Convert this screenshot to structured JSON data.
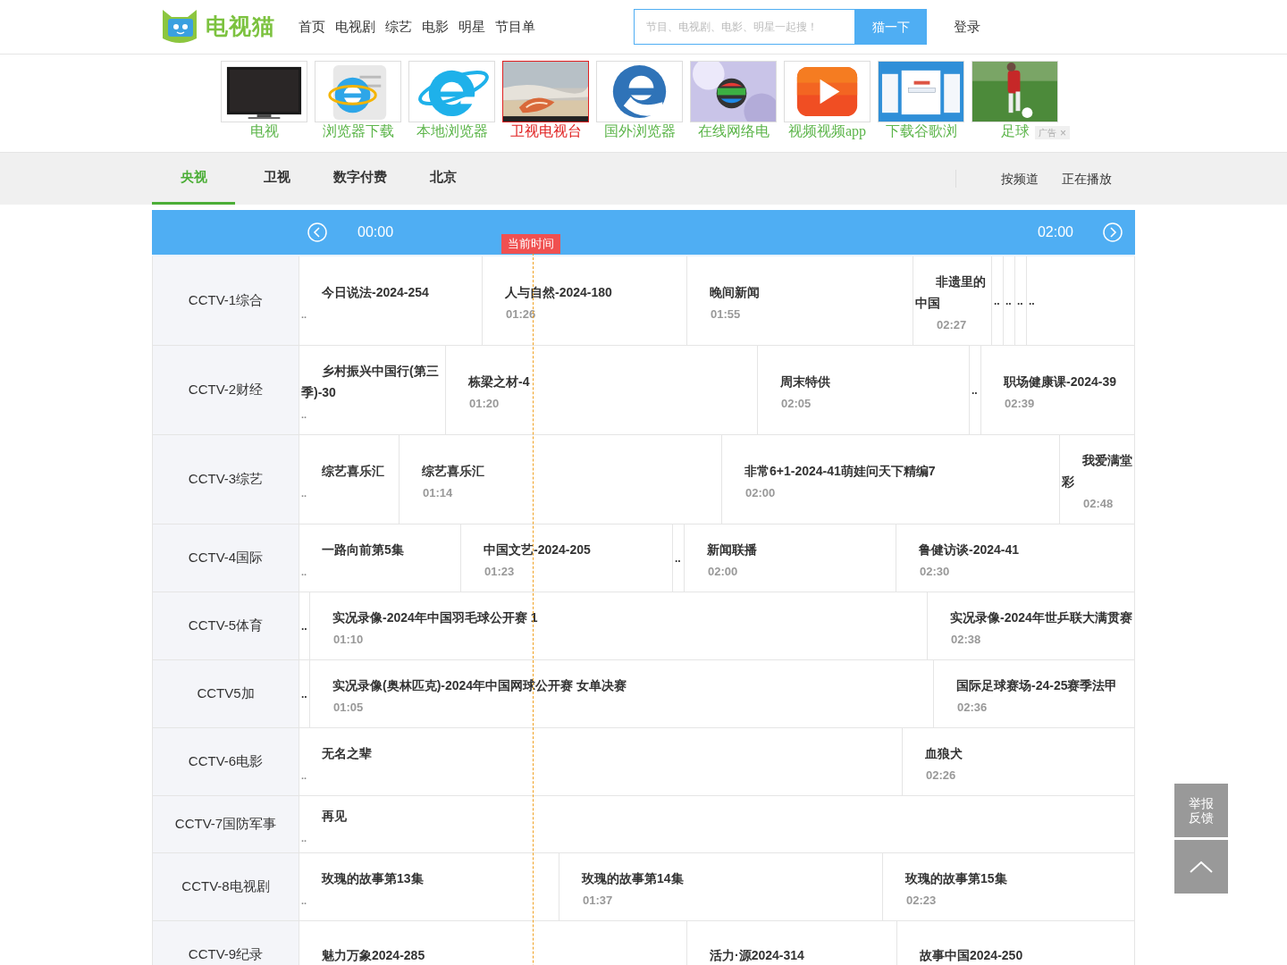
{
  "header": {
    "logo": "电视猫",
    "nav": [
      "首页",
      "电视剧",
      "综艺",
      "电影",
      "明星",
      "节目单"
    ],
    "search": {
      "placeholder": "节目、电视剧、电影、明星一起搜！",
      "button": "猫一下"
    },
    "login": "登录"
  },
  "ads": [
    {
      "label": "电视",
      "selected": false
    },
    {
      "label": "浏览器下载",
      "selected": false
    },
    {
      "label": "本地浏览器",
      "selected": false
    },
    {
      "label": "卫视电视台",
      "selected": true
    },
    {
      "label": "国外浏览器",
      "selected": false
    },
    {
      "label": "在线网络电",
      "selected": false
    },
    {
      "label": "视频视频app",
      "selected": false
    },
    {
      "label": "下载谷歌浏",
      "selected": false
    },
    {
      "label": "足球",
      "selected": false
    }
  ],
  "ad_badge": {
    "label": "广告",
    "close": "×"
  },
  "tabs": [
    {
      "label": "央视",
      "selected": true
    },
    {
      "label": "卫视",
      "selected": false
    },
    {
      "label": "数字付费",
      "selected": false
    },
    {
      "label": "北京",
      "selected": false
    }
  ],
  "view_links": [
    "按频道",
    "正在播放"
  ],
  "timeline": {
    "start": "00:00",
    "end": "02:00",
    "now_label": "当前时间"
  },
  "rows": [
    {
      "channel": "CCTV-1综合",
      "programs": [
        {
          "kind": "show",
          "title": "今日说法-2024-254",
          "more": ".."
        },
        {
          "kind": "show",
          "title": "人与自然-2024-180",
          "time": "01:26"
        },
        {
          "kind": "show",
          "title": "晚间新闻",
          "time": "01:55"
        },
        {
          "kind": "show",
          "title": "非遗里的中国",
          "time": "02:27"
        },
        {
          "kind": "gap",
          "text": ".."
        },
        {
          "kind": "gap",
          "text": ".."
        },
        {
          "kind": "gap",
          "text": ".."
        },
        {
          "kind": "gap",
          "text": ".."
        }
      ]
    },
    {
      "channel": "CCTV-2财经",
      "programs": [
        {
          "kind": "show",
          "title": "乡村振兴中国行(第三季)-30",
          "more": ".."
        },
        {
          "kind": "show",
          "title": "栋梁之材-4",
          "time": "01:20"
        },
        {
          "kind": "show",
          "title": "周末特供",
          "time": "02:05"
        },
        {
          "kind": "gap",
          "text": ".."
        },
        {
          "kind": "show",
          "title": "职场健康课-2024-39",
          "time": "02:39"
        }
      ]
    },
    {
      "channel": "CCTV-3综艺",
      "programs": [
        {
          "kind": "show",
          "title": "综艺喜乐汇",
          "more": ".."
        },
        {
          "kind": "show",
          "title": "综艺喜乐汇",
          "time": "01:14"
        },
        {
          "kind": "show",
          "title": "非常6+1-2024-41萌娃问天下精编7",
          "time": "02:00"
        },
        {
          "kind": "show",
          "title": "我爱满堂彩",
          "time": "02:48"
        }
      ]
    },
    {
      "channel": "CCTV-4国际",
      "programs": [
        {
          "kind": "show",
          "title": "一路向前第5集",
          "more": ".."
        },
        {
          "kind": "show",
          "title": "中国文艺-2024-205",
          "time": "01:23"
        },
        {
          "kind": "gap",
          "text": ".."
        },
        {
          "kind": "show",
          "title": "新闻联播",
          "time": "02:00"
        },
        {
          "kind": "show",
          "title": "鲁健访谈-2024-41",
          "time": "02:30"
        }
      ]
    },
    {
      "channel": "CCTV-5体育",
      "programs": [
        {
          "kind": "gap",
          "text": ".."
        },
        {
          "kind": "show",
          "title": "实况录像-2024年中国羽毛球公开赛 1",
          "time": "01:10"
        },
        {
          "kind": "show",
          "title": "实况录像-2024年世乒联大满贯赛",
          "time": "02:38"
        }
      ]
    },
    {
      "channel": "CCTV5加",
      "programs": [
        {
          "kind": "gap",
          "text": ".."
        },
        {
          "kind": "show",
          "title": "实况录像(奥林匹克)-2024年中国网球公开赛 女单决赛",
          "time": "01:05"
        },
        {
          "kind": "show",
          "title": "国际足球赛场-24-25赛季法甲",
          "time": "02:36"
        }
      ]
    },
    {
      "channel": "CCTV-6电影",
      "programs": [
        {
          "kind": "show",
          "title": "无名之辈",
          "more": ".."
        },
        {
          "kind": "show",
          "title": "血狼犬",
          "time": "02:26"
        }
      ]
    },
    {
      "channel": "CCTV-7国防军事",
      "programs": [
        {
          "kind": "show",
          "title": "再见",
          "more": ".."
        }
      ]
    },
    {
      "channel": "CCTV-8电视剧",
      "programs": [
        {
          "kind": "show",
          "title": "玫瑰的故事第13集",
          "more": ".."
        },
        {
          "kind": "show",
          "title": "玫瑰的故事第14集",
          "time": "01:37"
        },
        {
          "kind": "show",
          "title": "玫瑰的故事第15集",
          "time": "02:23"
        }
      ]
    },
    {
      "channel": "CCTV-9纪录",
      "programs": [
        {
          "kind": "show",
          "title": "魅力万象2024-285"
        },
        {
          "kind": "show",
          "title": "活力·源2024-314"
        },
        {
          "kind": "show",
          "title": "故事中国2024-250"
        }
      ]
    }
  ],
  "float_buttons": {
    "feedback": [
      "举报",
      "反馈"
    ]
  }
}
